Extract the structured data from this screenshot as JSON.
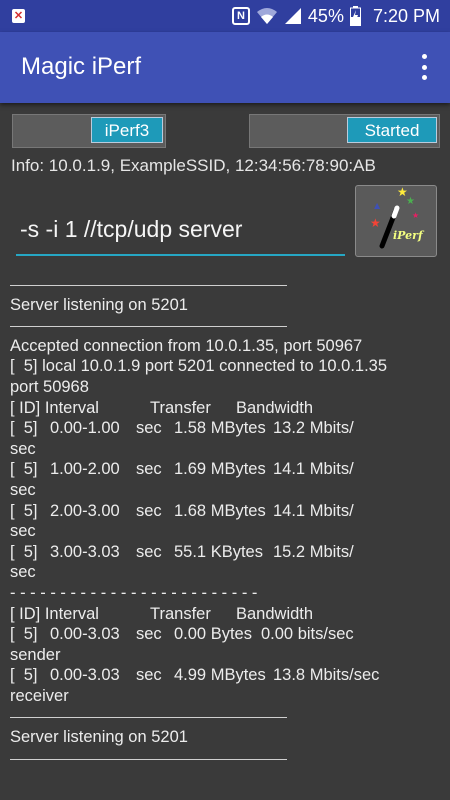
{
  "status_bar": {
    "battery": "45%",
    "time": "7:20 PM",
    "nfc": "N",
    "icons": [
      "notification-icon",
      "nfc-icon",
      "wifi-icon",
      "signal-icon",
      "battery-icon"
    ]
  },
  "app_bar": {
    "title": "Magic iPerf"
  },
  "toggles": {
    "mode_label": "iPerf3",
    "start_label": "Started"
  },
  "info": "Info: 10.0.1.9, ExampleSSID, 12:34:56:78:90:AB",
  "command": {
    "value": "-s -i 1 //tcp/udp server"
  },
  "run_button": {
    "label": "iPerf"
  },
  "log": {
    "listen1": "Server listening on 5201",
    "accepted": "Accepted connection from 10.0.1.35, port 50967",
    "local1": "[  5] local 10.0.1.9 port 5201 connected to 10.0.1.35",
    "local2": "port 50968",
    "header": {
      "id": "[ ID] Interval",
      "transfer": "Transfer",
      "bandwidth": "Bandwidth"
    },
    "rows": [
      {
        "id": "[  5]",
        "interval": "0.00-1.00",
        "unit": "sec",
        "transfer": "1.58 MBytes",
        "bw": "13.2 Mbits/",
        "wrap": "sec"
      },
      {
        "id": "[  5]",
        "interval": "1.00-2.00",
        "unit": "sec",
        "transfer": "1.69 MBytes",
        "bw": "14.1 Mbits/",
        "wrap": "sec"
      },
      {
        "id": "[  5]",
        "interval": "2.00-3.00",
        "unit": "sec",
        "transfer": "1.68 MBytes",
        "bw": "14.1 Mbits/",
        "wrap": "sec"
      },
      {
        "id": "[  5]",
        "interval": "3.00-3.03",
        "unit": "sec",
        "transfer": "55.1 KBytes",
        "bw": "15.2 Mbits/",
        "wrap": "sec"
      }
    ],
    "dashes": "- - - - - - - - - - - - - - - - - - - - - - - - -",
    "summary": [
      {
        "id": "[  5]",
        "interval": "0.00-3.03",
        "unit": "sec",
        "transfer": "0.00 Bytes",
        "bw": "0.00 bits/sec",
        "wrap": "sender"
      },
      {
        "id": "[  5]",
        "interval": "0.00-3.03",
        "unit": "sec",
        "transfer": "4.99 MBytes",
        "bw": "13.8 Mbits/sec",
        "wrap": "receiver"
      }
    ],
    "listen2": "Server listening on 5201"
  },
  "colors": {
    "status_bar": "#303f9f",
    "app_bar": "#3f51b5",
    "accent": "#1e9ab9",
    "background": "#3a3a3a"
  }
}
